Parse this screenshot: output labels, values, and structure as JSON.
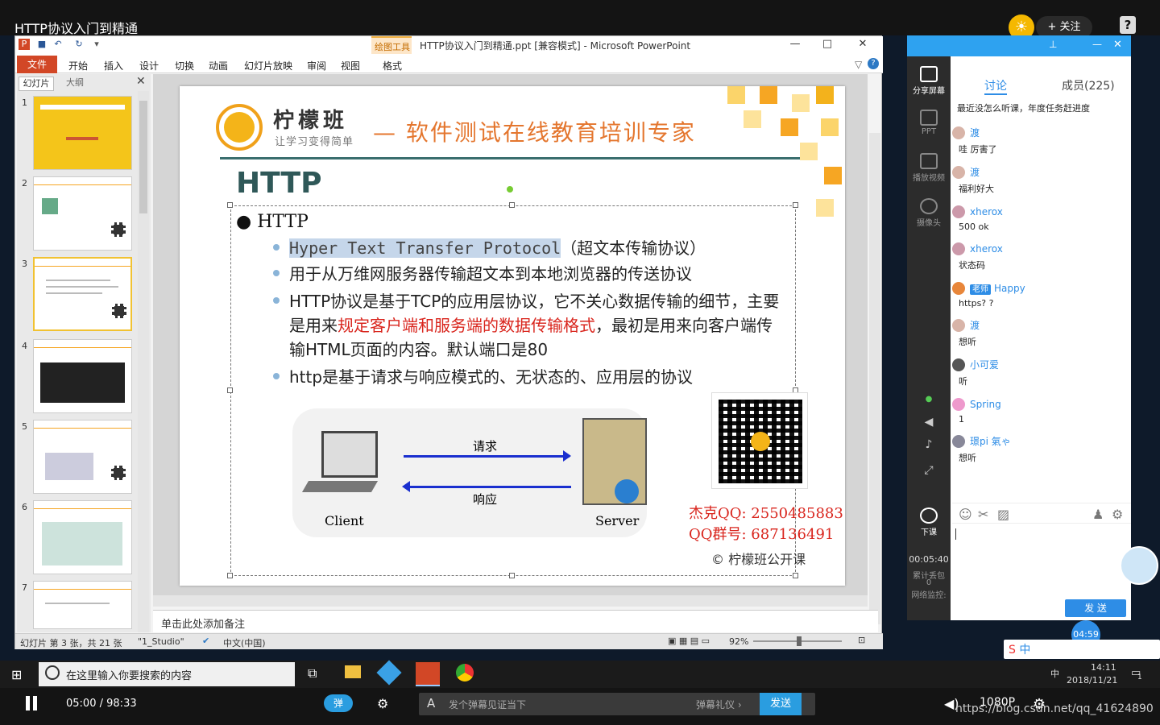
{
  "player": {
    "title": "HTTP协议入门到精通",
    "follow": "+ 关注",
    "help": "?",
    "time_current": "05:00",
    "time_sep": "/",
    "time_total": "98:33",
    "danmu_toggle": "弹",
    "danmu_placeholder": "发个弹幕见证当下",
    "danmu_gift": "弹幕礼仪 ›",
    "danmu_send": "发送",
    "quality": "1080P",
    "watermark": "https://blog.csdn.net/qq_41624890"
  },
  "ppt": {
    "window_title": "HTTP协议入门到精通.ppt [兼容模式] - Microsoft PowerPoint",
    "context_tab": "绘图工具",
    "context_sub": "格式",
    "file_tab": "文件",
    "tabs": [
      "开始",
      "插入",
      "设计",
      "切换",
      "动画",
      "幻灯片放映",
      "审阅",
      "视图"
    ],
    "pane_tabs": [
      "幻灯片",
      "大纲"
    ],
    "thumb_numbers": [
      "1",
      "2",
      "3",
      "4",
      "5",
      "6",
      "7"
    ],
    "notes_placeholder": "单击此处添加备注",
    "status": {
      "slide_info": "幻灯片 第 3 张，共 21 张",
      "theme": "\"1_Studio\"",
      "language": "中文(中国)",
      "zoom": "92%"
    }
  },
  "slide": {
    "brand": "柠檬班",
    "brand_sub": "让学习变得简单",
    "tagline": "— 软件测试在线教育培训专家",
    "heading": "HTTP",
    "bullet_main": "HTTP",
    "bullets": [
      {
        "hl": "Hyper Text Transfer Protocol",
        "rest": "（超文本传输协议）"
      },
      {
        "text": "用于从万维网服务器传输超文本到本地浏览器的传送协议"
      },
      {
        "a": "HTTP协议是基于TCP的应用层协议，它不关心数据传输的细节，主要是用来",
        "red": "规定客户端和服务端的数据传输格式",
        "b": "，最初是用来向客户端传输HTML页面的内容。默认端口是80"
      },
      {
        "text": "http是基于请求与响应模式的、无状态的、应用层的协议"
      }
    ],
    "request": "请求",
    "response": "响应",
    "client": "Client",
    "server": "Server",
    "contact_qq": "杰克QQ: 2550485883",
    "contact_group": "QQ群号: 687136491",
    "copyright": "© 柠檬班公开课"
  },
  "chat": {
    "tabs": [
      "讨论",
      "成员(225)"
    ],
    "side": [
      "分享屏幕",
      "PPT",
      "播放视频",
      "摄像头",
      "下课"
    ],
    "session_time": "00:05:40",
    "packet_loss": "累计丢包",
    "loss_value": "0",
    "net_monitor": "网络监控:",
    "first": "最近没怎么听课，年度任务赶进度",
    "messages": [
      {
        "name": "渡",
        "text": "哇 厉害了"
      },
      {
        "name": "渡",
        "text": "福利好大"
      },
      {
        "name": "xherox",
        "text": "500 ok"
      },
      {
        "name": "xherox",
        "text": "状态码"
      },
      {
        "badge": "老师",
        "name": "Happy",
        "text": "https? ?"
      },
      {
        "name": "渡",
        "text": "想听"
      },
      {
        "name": "小可爱",
        "text": "听"
      },
      {
        "name": "Spring",
        "text": "1"
      },
      {
        "name": "璟pi 氣ゃ",
        "text": "想听"
      }
    ],
    "send": "发 送",
    "timer": "04:59"
  },
  "taskbar": {
    "search": "在这里输入你要搜索的内容",
    "time": "14:11",
    "date": "2018/11/21",
    "ime": "中",
    "notif": "1"
  },
  "colors": {
    "accent": "#2e8de6",
    "ppt_red": "#d24726",
    "slide_orange": "#e4762e",
    "highlight_red": "#d9251d"
  }
}
